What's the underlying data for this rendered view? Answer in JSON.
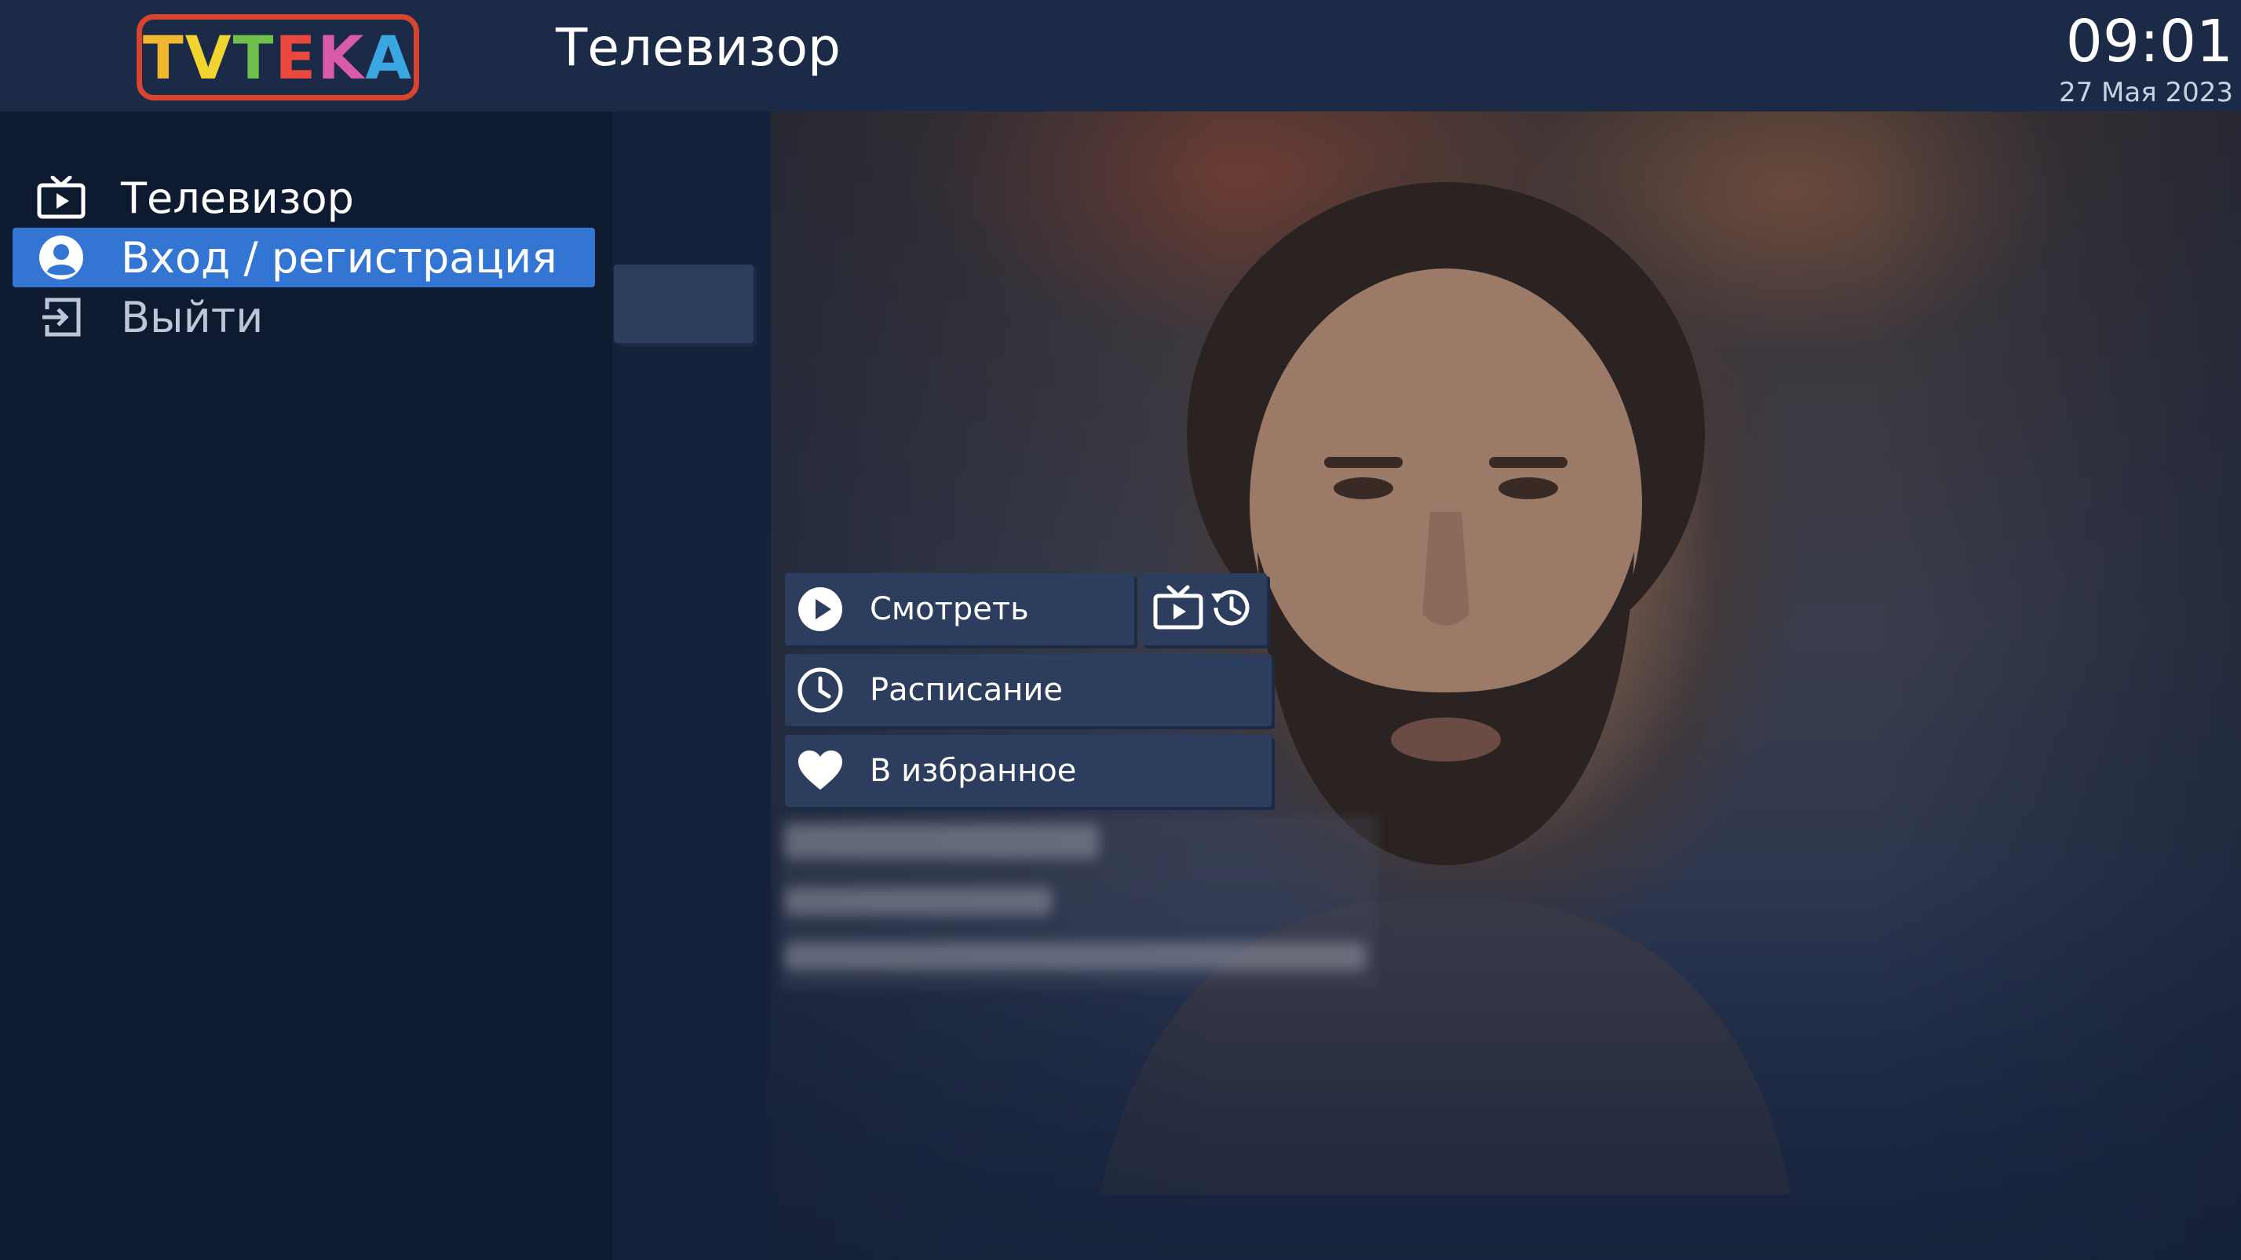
{
  "header": {
    "logo_text": "TVTEKA",
    "logo_letters": [
      {
        "ch": "T",
        "color": "#f2b731"
      },
      {
        "ch": "V",
        "color": "#f2d431"
      },
      {
        "ch": "T",
        "color": "#6fbf4b"
      },
      {
        "ch": "E",
        "color": "#e8483d"
      },
      {
        "ch": "K",
        "color": "#d95aa7"
      },
      {
        "ch": "A",
        "color": "#3aa7e0"
      }
    ],
    "title": "Телевизор",
    "time": "09:01",
    "date": "27 Мая 2023"
  },
  "sidebar": {
    "items": [
      {
        "label": "Телевизор",
        "icon": "tv-icon",
        "state": "normal"
      },
      {
        "label": "Вход / регистрация",
        "icon": "user-icon",
        "state": "active"
      },
      {
        "label": "Выйти",
        "icon": "logout-icon",
        "state": "dim"
      }
    ]
  },
  "actions": {
    "watch": {
      "label": "Смотреть",
      "icon": "play-icon"
    },
    "archive": {
      "icons": [
        "tv-icon",
        "history-icon"
      ]
    },
    "schedule": {
      "label": "Расписание",
      "icon": "clock-icon"
    },
    "favorite": {
      "label": "В избранное",
      "icon": "heart-icon"
    }
  },
  "colors": {
    "header_bg": "#1b2a47",
    "sidebar_bg": "#0e1a2f",
    "active_item": "#3375d3",
    "button_bg": "#2c3d5e",
    "logo_border": "#d9442f"
  }
}
